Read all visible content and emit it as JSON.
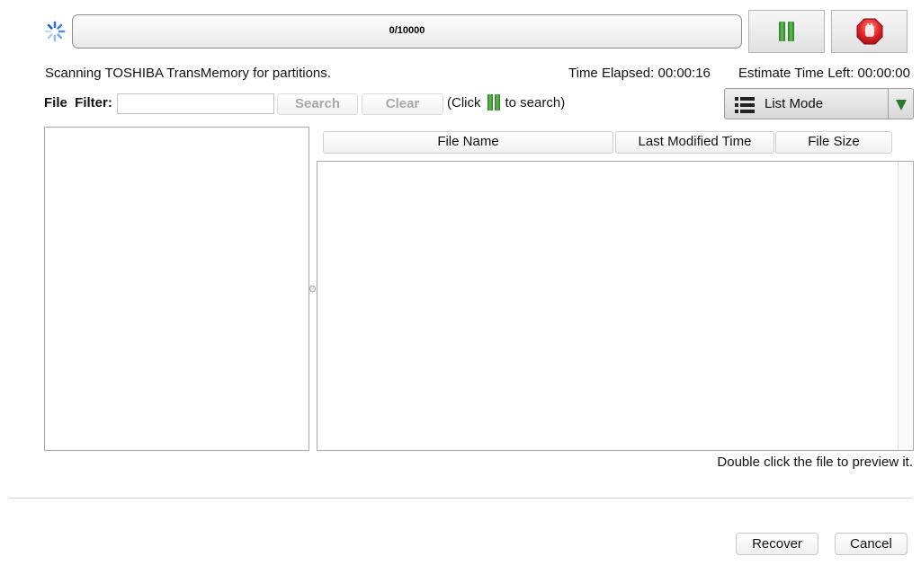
{
  "progress": {
    "text": "0/10000",
    "fraction": 0
  },
  "status": {
    "message": "Scanning TOSHIBA TransMemory for partitions.",
    "elapsed": "Time Elapsed: 00:00:16",
    "estimate": "Estimate Time Left: 00:00:00"
  },
  "filter": {
    "label": "File  Filter:",
    "value": "",
    "search_label": "Search",
    "clear_label": "Clear",
    "hint_prefix": "(Click",
    "hint_suffix": "to search)"
  },
  "view_mode": {
    "selected": "List Mode",
    "icon": "list-icon"
  },
  "columns": [
    "File Name",
    "Last Modified Time",
    "File Size"
  ],
  "files": [],
  "preview_hint": "Double click the file to preview it.",
  "buttons": {
    "recover": "Recover",
    "cancel": "Cancel"
  },
  "icons": {
    "pause": "pause-icon",
    "stop": "stop-icon",
    "loading": "loading-spinner-icon"
  },
  "colors": {
    "pause_green": "#3a9a3a",
    "stop_red": "#e0262a",
    "dropdown_arrow": "#2a7a2a"
  }
}
